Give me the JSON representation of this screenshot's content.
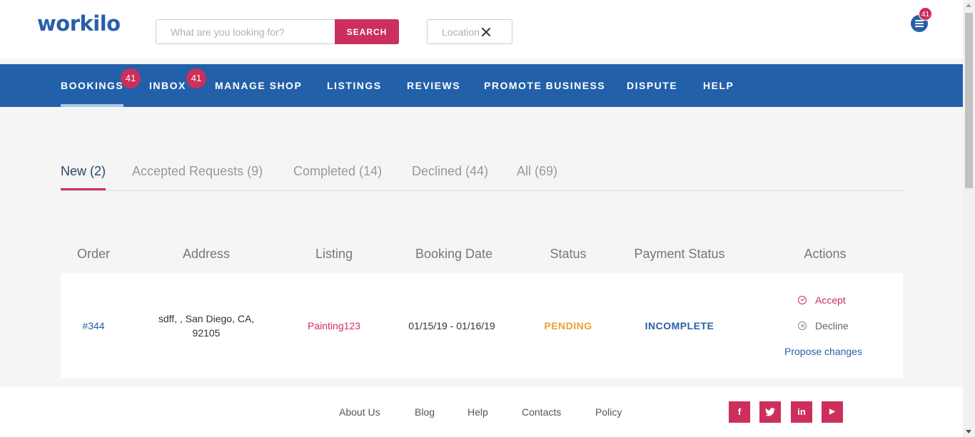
{
  "header": {
    "logo": "workilo",
    "search_placeholder": "What are you looking for?",
    "search_button": "SEARCH",
    "location_placeholder": "Location",
    "menu_badge": "41"
  },
  "nav": {
    "items": [
      {
        "label": "BOOKINGS",
        "badge": "41",
        "active": true
      },
      {
        "label": "INBOX",
        "badge": "41"
      },
      {
        "label": "MANAGE SHOP"
      },
      {
        "label": "LISTINGS"
      },
      {
        "label": "REVIEWS"
      },
      {
        "label": "PROMOTE BUSINESS"
      },
      {
        "label": "DISPUTE"
      },
      {
        "label": "HELP"
      }
    ]
  },
  "tabs": [
    {
      "label": "New (2)",
      "active": true
    },
    {
      "label": "Accepted Requests (9)"
    },
    {
      "label": "Completed (14)"
    },
    {
      "label": "Declined (44)"
    },
    {
      "label": "All (69)"
    }
  ],
  "table": {
    "columns": [
      "Order",
      "Address",
      "Listing",
      "Booking Date",
      "Status",
      "Payment Status",
      "Actions"
    ],
    "rows": [
      {
        "order": "#344",
        "address": "sdff, , San Diego, CA, 92105",
        "listing": "Painting123",
        "booking_date": "01/15/19 - 01/16/19",
        "status": "PENDING",
        "payment_status": "INCOMPLETE",
        "actions": {
          "accept": "Accept",
          "decline": "Decline",
          "propose": "Propose changes"
        }
      }
    ]
  },
  "footer": {
    "links": [
      "About Us",
      "Blog",
      "Help",
      "Contacts",
      "Policy"
    ],
    "social": [
      {
        "name": "facebook-icon",
        "glyph": "f"
      },
      {
        "name": "twitter-icon",
        "glyph": "t"
      },
      {
        "name": "linkedin-icon",
        "glyph": "in"
      },
      {
        "name": "youtube-icon",
        "glyph": "▶"
      }
    ]
  },
  "colors": {
    "brand_blue": "#2360aa",
    "accent_pink": "#cc2f5c",
    "pending_orange": "#f0a030"
  }
}
